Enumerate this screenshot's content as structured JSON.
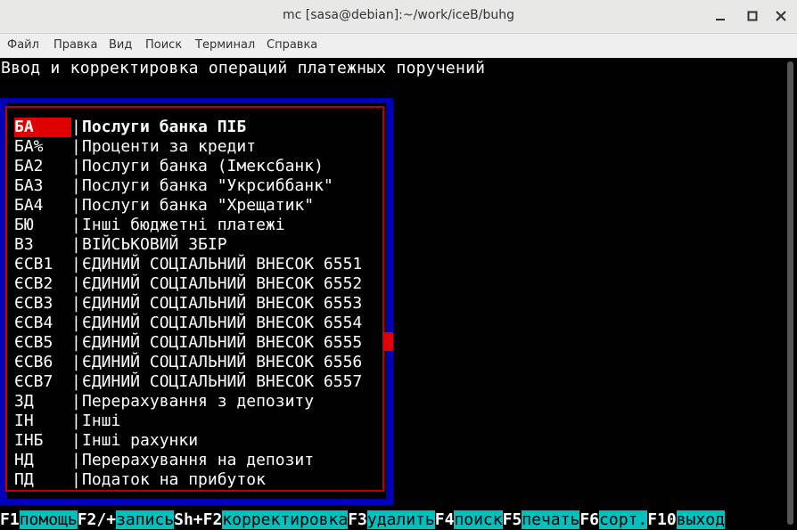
{
  "window": {
    "title": "mc [sasa@debian]:~/work/iceB/buhg"
  },
  "menubar": {
    "items": [
      "Файл",
      "Правка",
      "Вид",
      "Поиск",
      "Терминал",
      "Справка"
    ]
  },
  "terminal": {
    "header": "Ввод и корректировка операций платежных поручений",
    "list": [
      {
        "code": "БА",
        "name": "Послуги банка ПІБ",
        "selected": true
      },
      {
        "code": "БА%",
        "name": "Проценти за кредит"
      },
      {
        "code": "БА2",
        "name": "Послуги банка (Імексбанк)"
      },
      {
        "code": "БА3",
        "name": "Послуги банка \"Укрсиббанк\""
      },
      {
        "code": "БА4",
        "name": "Послуги банка \"Хрещатик\""
      },
      {
        "code": "БЮ",
        "name": "Інші бюджетні платежі"
      },
      {
        "code": "ВЗ",
        "name": "ВІЙСЬКОВИЙ ЗБІР"
      },
      {
        "code": "ЄСВ1",
        "name": "ЄДИНИЙ СОЦІАЛЬНИЙ ВНЕСОК 6551"
      },
      {
        "code": "ЄСВ2",
        "name": "ЄДИНИЙ СОЦІАЛЬНИЙ ВНЕСОК 6552"
      },
      {
        "code": "ЄСВ3",
        "name": "ЄДИНИЙ СОЦІАЛЬНИЙ ВНЕСОК 6553"
      },
      {
        "code": "ЄСВ4",
        "name": "ЄДИНИЙ СОЦІАЛЬНИЙ ВНЕСОК 6554"
      },
      {
        "code": "ЄСВ5",
        "name": "ЄДИНИЙ СОЦІАЛЬНИЙ ВНЕСОК 6555"
      },
      {
        "code": "ЄСВ6",
        "name": "ЄДИНИЙ СОЦІАЛЬНИЙ ВНЕСОК 6556"
      },
      {
        "code": "ЄСВ7",
        "name": "ЄДИНИЙ СОЦІАЛЬНИЙ ВНЕСОК 6557"
      },
      {
        "code": "ЗД",
        "name": "Перерахування з депозиту"
      },
      {
        "code": "ІН",
        "name": "Інші"
      },
      {
        "code": "ІНБ",
        "name": "Інші рахунки"
      },
      {
        "code": "НД",
        "name": "Перерахування на депозит"
      },
      {
        "code": "ПД",
        "name": "Податок на прибуток"
      }
    ],
    "separator": "|",
    "fkeys": [
      {
        "key": "F1",
        "label": "помощь"
      },
      {
        "key": "F2/+",
        "label": "запись"
      },
      {
        "key": "Sh+F2",
        "label": "корректировка"
      },
      {
        "key": "F3",
        "label": "удалить"
      },
      {
        "key": "F4",
        "label": "поиск"
      },
      {
        "key": "F5",
        "label": "печать"
      },
      {
        "key": "F6",
        "label": "сорт."
      },
      {
        "key": "F10",
        "label": "выход"
      }
    ]
  },
  "colors": {
    "panel": "#0000b8",
    "border": "#c00000",
    "selection": "#e00000",
    "fkey_label_bg": "#00c0c0"
  },
  "icons": [
    "minimize-icon",
    "maximize-icon",
    "close-icon"
  ]
}
